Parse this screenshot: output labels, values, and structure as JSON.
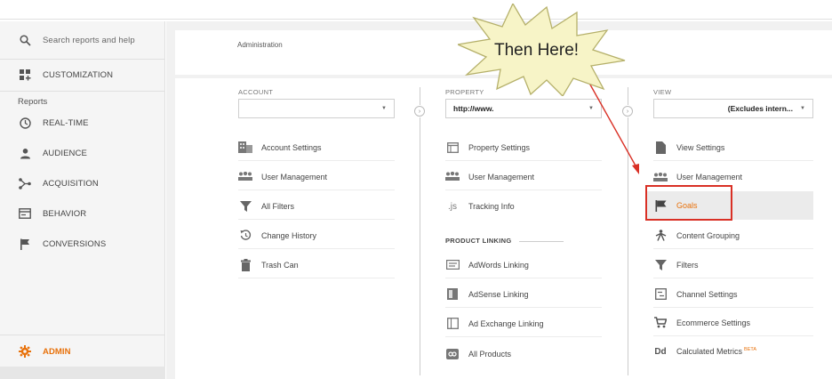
{
  "sidebar": {
    "search_placeholder": "Search reports and help",
    "customization": "CUSTOMIZATION",
    "reports_section": "Reports",
    "items": [
      {
        "label": "REAL-TIME",
        "icon": "clock-icon"
      },
      {
        "label": "AUDIENCE",
        "icon": "person-icon"
      },
      {
        "label": "ACQUISITION",
        "icon": "acquisition-icon"
      },
      {
        "label": "BEHAVIOR",
        "icon": "behavior-icon"
      },
      {
        "label": "CONVERSIONS",
        "icon": "flag-icon"
      }
    ],
    "admin": "ADMIN"
  },
  "main": {
    "title": "Administration",
    "account": {
      "label": "ACCOUNT",
      "selected": "",
      "items": [
        {
          "label": "Account Settings",
          "icon": "building-icon"
        },
        {
          "label": "User Management",
          "icon": "users-icon"
        },
        {
          "label": "All Filters",
          "icon": "filter-icon"
        },
        {
          "label": "Change History",
          "icon": "history-icon"
        },
        {
          "label": "Trash Can",
          "icon": "trash-icon"
        }
      ]
    },
    "property": {
      "label": "PROPERTY",
      "selected": "http://www.",
      "items": [
        {
          "label": "Property Settings",
          "icon": "window-icon"
        },
        {
          "label": "User Management",
          "icon": "users-icon"
        },
        {
          "label": "Tracking Info",
          "icon": "js-icon"
        }
      ],
      "linking_header": "PRODUCT LINKING",
      "linking_items": [
        {
          "label": "AdWords Linking",
          "icon": "adwords-icon"
        },
        {
          "label": "AdSense Linking",
          "icon": "adsense-icon"
        },
        {
          "label": "Ad Exchange Linking",
          "icon": "adexchange-icon"
        },
        {
          "label": "All Products",
          "icon": "link-icon"
        }
      ]
    },
    "view": {
      "label": "VIEW",
      "selected": "(Excludes intern...",
      "items": [
        {
          "label": "View Settings",
          "icon": "document-icon"
        },
        {
          "label": "User Management",
          "icon": "users-icon"
        },
        {
          "label": "Goals",
          "icon": "flag-icon"
        },
        {
          "label": "Content Grouping",
          "icon": "grouping-icon"
        },
        {
          "label": "Filters",
          "icon": "filter-icon"
        },
        {
          "label": "Channel Settings",
          "icon": "channel-icon"
        },
        {
          "label": "Ecommerce Settings",
          "icon": "cart-icon"
        },
        {
          "label": "Calculated Metrics",
          "icon": "dd-icon",
          "badge": "BETA"
        }
      ]
    }
  },
  "annotation": {
    "callout": "Then Here!"
  },
  "colors": {
    "accent_orange": "#e8710a",
    "highlight_red": "#d93025",
    "burst_fill": "#f7f4c7"
  }
}
